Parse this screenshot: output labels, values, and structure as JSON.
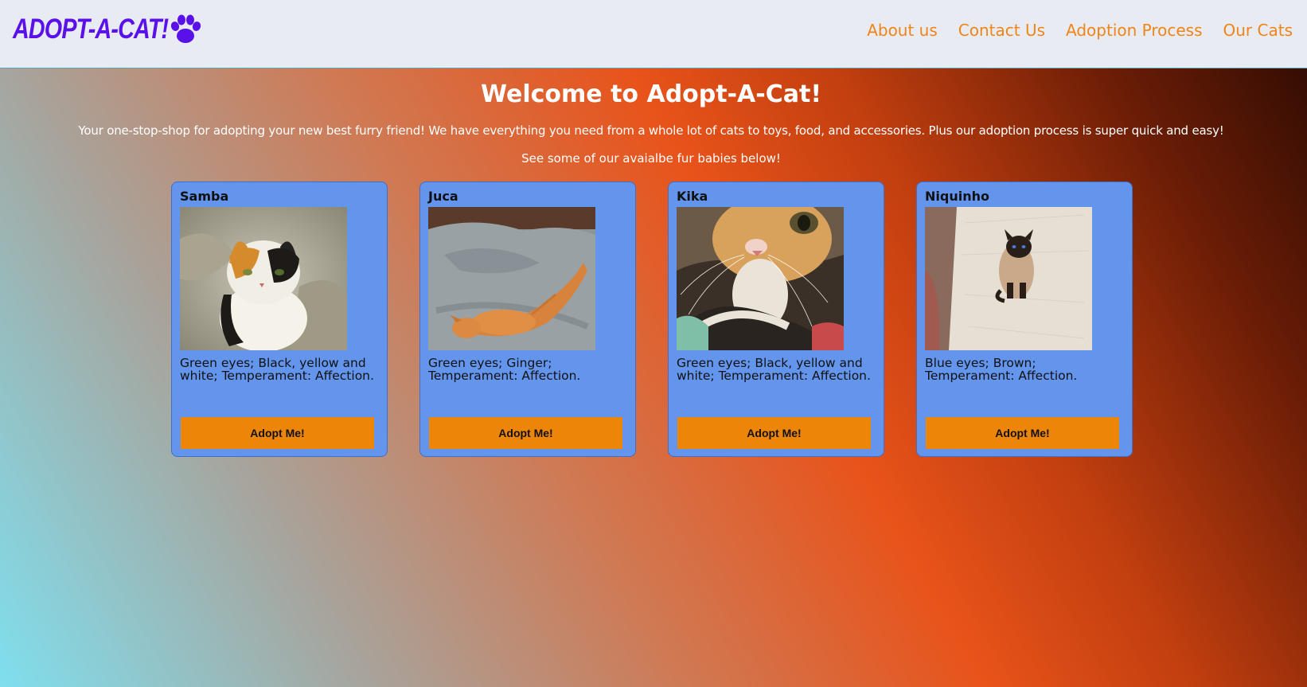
{
  "brand": {
    "name": "ADOPT-A-CAT!",
    "icon": "paw-icon",
    "color": "#5a10e8"
  },
  "nav": {
    "links": [
      "About us",
      "Contact Us",
      "Adoption Process",
      "Our Cats"
    ],
    "color": "#ef8418"
  },
  "hero": {
    "title": "Welcome to Adopt-A-Cat!",
    "subtitle": "Your one-stop-shop for adopting your new best furry friend! We have everything you need from a whole lot of cats to toys, food, and accessories. Plus our adoption process is super quick and easy!",
    "subtitle2": "See some of our avaialbe fur babies below!"
  },
  "cats": [
    {
      "name": "Samba",
      "description": "Green eyes; Black, yellow and white; Temperament: Affection.",
      "button": "Adopt Me!",
      "photo": "calico-kitten-photo"
    },
    {
      "name": "Juca",
      "description": "Green eyes; Ginger; Temperament: Affection.",
      "button": "Adopt Me!",
      "photo": "ginger-cat-lying-photo"
    },
    {
      "name": "Kika",
      "description": "Green eyes; Black, yellow and white; Temperament: Affection.",
      "button": "Adopt Me!",
      "photo": "calico-closeup-photo"
    },
    {
      "name": "Niquinho",
      "description": "Blue eyes; Brown; Temperament: Affection.",
      "button": "Adopt Me!",
      "photo": "siamese-cat-photo"
    }
  ],
  "colors": {
    "card": "#6495ed",
    "button": "#ed8508",
    "navbar": "#e9ebf3"
  }
}
